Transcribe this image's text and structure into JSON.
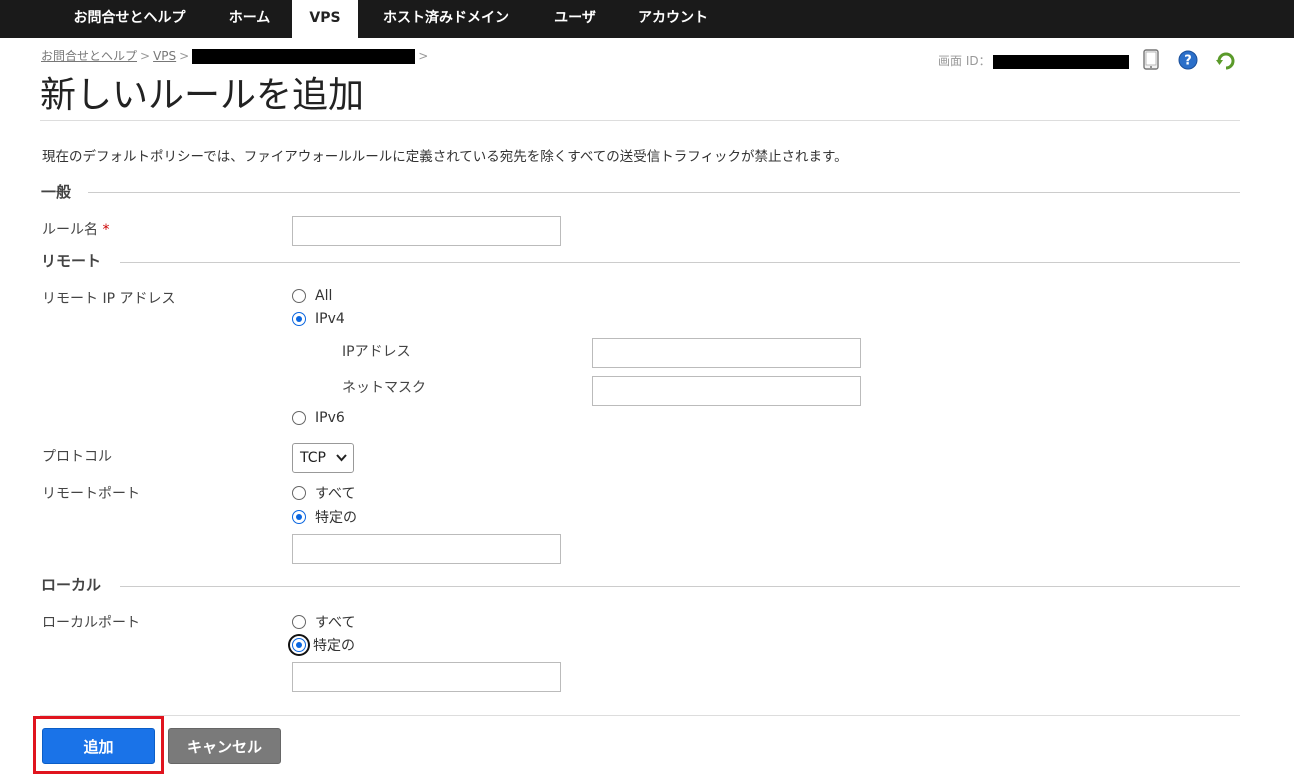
{
  "nav": {
    "tabs": [
      {
        "label": "お問合せとヘルプ",
        "active": false
      },
      {
        "label": "ホーム",
        "active": false
      },
      {
        "label": "VPS",
        "active": true
      },
      {
        "label": "ホスト済みドメイン",
        "active": false
      },
      {
        "label": "ユーザ",
        "active": false
      },
      {
        "label": "アカウント",
        "active": false
      }
    ]
  },
  "breadcrumb": {
    "items": [
      "お問合せとヘルプ",
      "VPS"
    ],
    "separator": ">"
  },
  "screen_id": {
    "label": "画面 ID："
  },
  "icons": {
    "tablet": "tablet-icon",
    "help": "help-icon",
    "refresh": "refresh-icon"
  },
  "page": {
    "title": "新しいルールを追加",
    "description": "現在のデフォルトポリシーでは、ファイアウォールルールに定義されている宛先を除くすべての送受信トラフィックが禁止されます。"
  },
  "general": {
    "heading": "一般",
    "rule_name_label": "ルール名",
    "required_mark": "*",
    "rule_name_value": ""
  },
  "remote": {
    "heading": "リモート",
    "ip_label": "リモート IP アドレス",
    "ip_options": [
      "All",
      "IPv4",
      "IPv6"
    ],
    "ip_selected": "IPv4",
    "ip_address_label": "IPアドレス",
    "netmask_label": "ネットマスク",
    "protocol_label": "プロトコル",
    "protocol_value": "TCP",
    "port_label": "リモートポート",
    "port_options": [
      "すべて",
      "特定の"
    ],
    "port_selected": "特定の"
  },
  "local": {
    "heading": "ローカル",
    "port_label": "ローカルポート",
    "port_options": [
      "すべて",
      "特定の"
    ],
    "port_selected": "特定の"
  },
  "actions": {
    "add": "追加",
    "cancel": "キャンセル"
  },
  "colors": {
    "nav_bg": "#1a1a1a",
    "primary": "#1a73e8",
    "secondary": "#7a7a7a",
    "highlight": "#e0141e",
    "required": "#cc0000"
  }
}
